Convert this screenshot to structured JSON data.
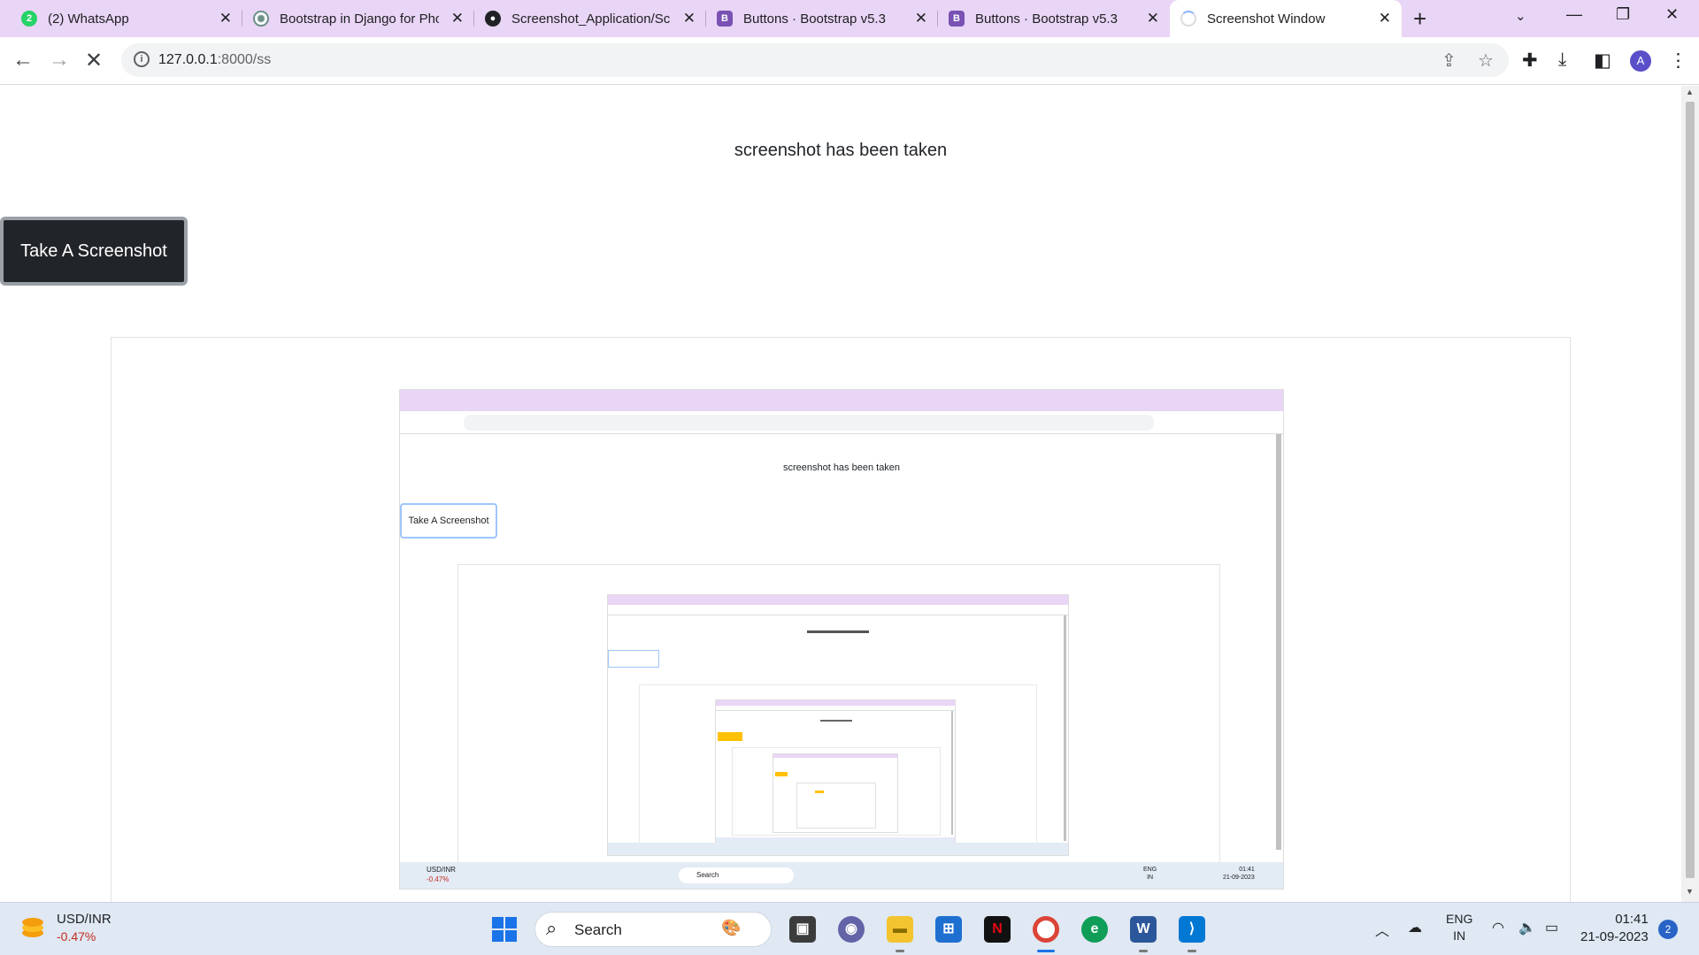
{
  "browser": {
    "tabs": [
      {
        "title": "(2) WhatsApp",
        "favicon": "whatsapp-icon"
      },
      {
        "title": "Bootstrap in Django for Pho",
        "favicon": "chatgpt-icon"
      },
      {
        "title": "Screenshot_Application/Scr",
        "favicon": "github-icon"
      },
      {
        "title": "Buttons · Bootstrap v5.3",
        "favicon": "bootstrap-icon"
      },
      {
        "title": "Buttons · Bootstrap v5.3",
        "favicon": "bootstrap-icon"
      },
      {
        "title": "Screenshot Window",
        "favicon": "loading-icon"
      }
    ],
    "address": {
      "host": "127.0.0.1",
      "rest": ":8000/ss"
    },
    "profile_initial": "A"
  },
  "page": {
    "status_text": "screenshot has been taken",
    "button_label": "Take A Screenshot"
  },
  "nested": {
    "status_text": "screenshot has been taken",
    "button_label": "Take A Screenshot",
    "usd_label": "USD/INR",
    "usd_change": "-0.47%",
    "search_label": "Search",
    "lang": "ENG",
    "region": "IN",
    "time": "01:41",
    "date": "21-09-2023"
  },
  "taskbar": {
    "ticker_label": "USD/INR",
    "ticker_change": "-0.47%",
    "search_label": "Search",
    "lang": "ENG",
    "region": "IN",
    "time": "01:41",
    "date": "21-09-2023",
    "notifications": "2"
  },
  "colors": {
    "tabstrip": "#e9d5f5",
    "button_dark": "#212529",
    "ticker_down": "#c42b1c",
    "bootstrap": "#7952b3",
    "whatsapp": "#25d366"
  }
}
